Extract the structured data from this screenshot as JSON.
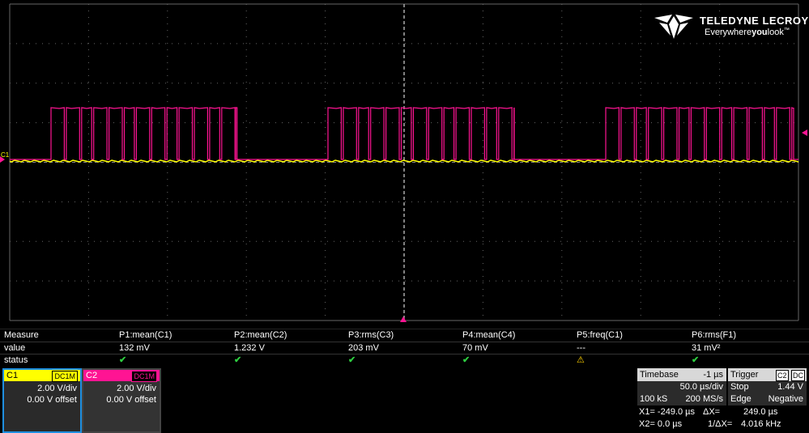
{
  "logo": {
    "brand": "TELEDYNE LECROY",
    "tagline_a": "Everywhere",
    "tagline_b": "you",
    "tagline_c": "look",
    "tagline_tm": "™"
  },
  "colors": {
    "c1": "#ffff00",
    "c2": "#ff1493",
    "grid": "#555555",
    "bg": "#000000"
  },
  "scope": {
    "trace_label": "C1",
    "trigger_marker": "trigger-icon"
  },
  "measure": {
    "headers": [
      "Measure",
      "P1:mean(C1)",
      "P2:mean(C2)",
      "P3:rms(C3)",
      "P4:mean(C4)",
      "P5:freq(C1)",
      "P6:rms(F1)"
    ],
    "value": [
      "value",
      "132 mV",
      "1.232 V",
      "203 mV",
      "70 mV",
      "---",
      "31 mV²"
    ],
    "status_label": "status",
    "status": [
      "check-icon",
      "check-icon",
      "check-icon",
      "check-icon",
      "warning-icon",
      "check-icon"
    ]
  },
  "channels": [
    {
      "name": "C1",
      "coupling": "DC1M",
      "vdiv": "2.00 V/div",
      "offset": "0.00 V offset"
    },
    {
      "name": "C2",
      "coupling": "DC1M",
      "vdiv": "2.00 V/div",
      "offset": "0.00 V offset"
    }
  ],
  "timebase": {
    "title": "Timebase",
    "delay": "-1 µs",
    "tdiv": "50.0 µs/div",
    "samples": "100 kS",
    "rate": "200 MS/s"
  },
  "trigger": {
    "title": "Trigger",
    "src": "C2",
    "coupling": "DC",
    "mode": "Stop",
    "level": "1.44 V",
    "type": "Edge",
    "slope": "Negative"
  },
  "cursors": {
    "x1": "X1= -249.0 µs",
    "dx": "ΔX=",
    "dx_val": "249.0 µs",
    "x2": "X2= 0.0 µs",
    "inv": "1/ΔX=",
    "inv_val": "4.016 kHz"
  }
}
